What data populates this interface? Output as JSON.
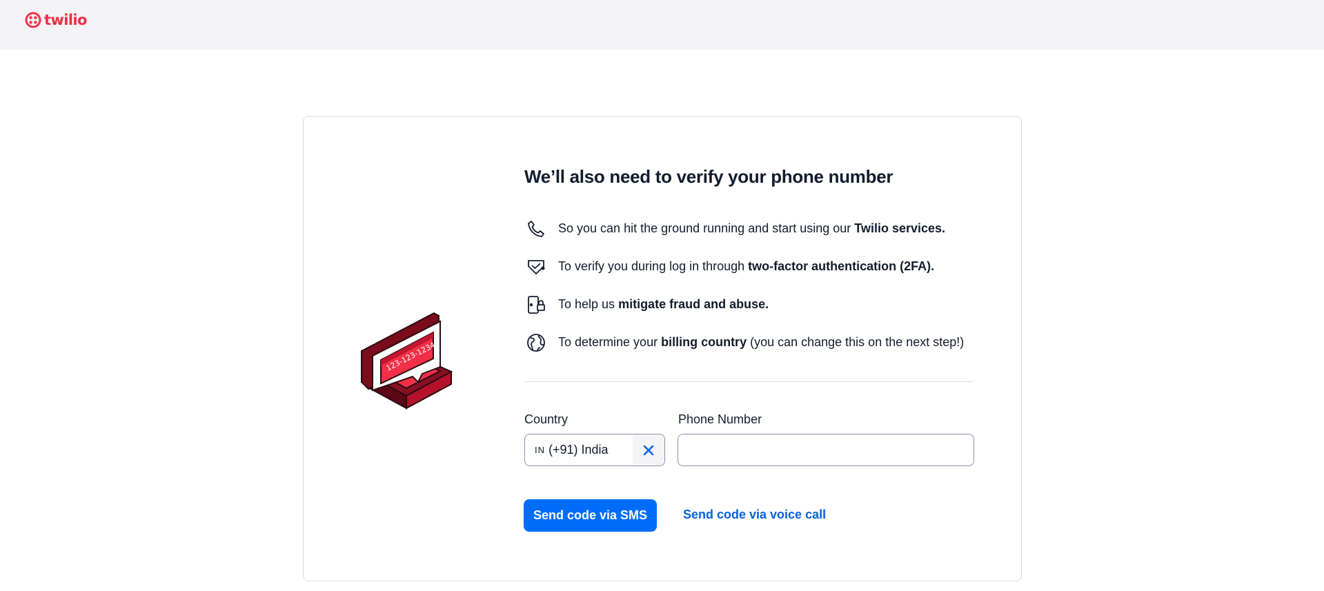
{
  "header": {
    "logo_text": "twilio",
    "brand_color": "#f22f46"
  },
  "illustration": {
    "number_text": "123-123-1234"
  },
  "main": {
    "title": "We’ll also need to verify your phone number",
    "reasons": [
      {
        "icon": "phone-icon",
        "text_before": "So you can hit the ground running and start using our ",
        "bold": "Twilio services.",
        "text_after": ""
      },
      {
        "icon": "shield-check-icon",
        "text_before": "To verify you during log in through ",
        "bold": "two-factor authentication (2FA).",
        "text_after": ""
      },
      {
        "icon": "device-lock-icon",
        "text_before": "To help us ",
        "bold": "mitigate fraud and abuse.",
        "text_after": ""
      },
      {
        "icon": "globe-icon",
        "text_before": "To determine your ",
        "bold": "billing country",
        "text_after": " (you can change this on the next step!)"
      }
    ]
  },
  "form": {
    "country_label": "Country",
    "country_flag": "IN",
    "country_value": "(+91) India",
    "phone_label": "Phone Number",
    "phone_value": "",
    "phone_placeholder": ""
  },
  "actions": {
    "sms_button": "Send code via SMS",
    "voice_link": "Send code via voice call",
    "primary_color": "#006dfa",
    "link_color": "#0263e0"
  }
}
